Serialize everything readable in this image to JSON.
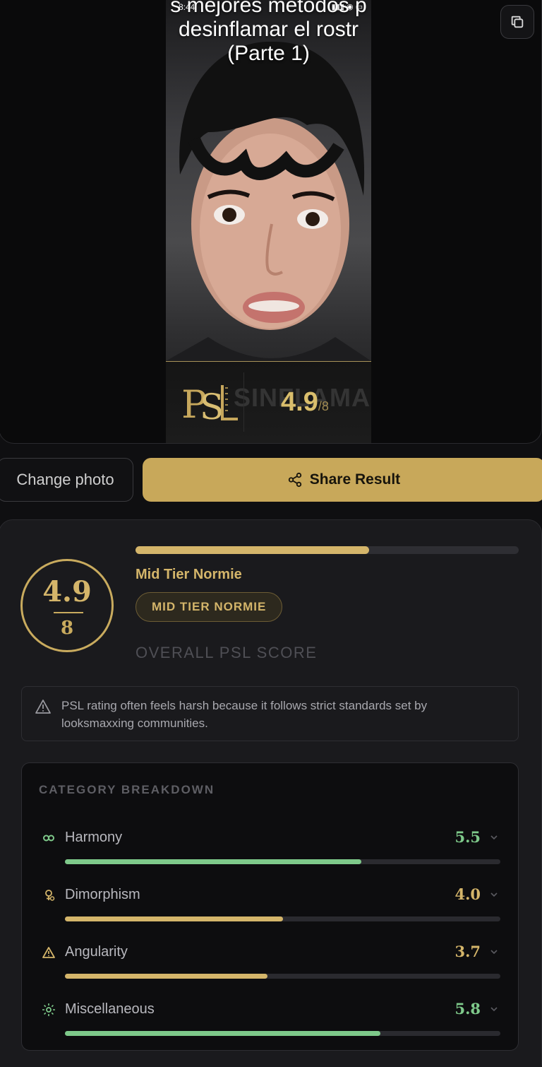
{
  "photo": {
    "overlay_line1": "s mejores métodos p",
    "overlay_line2": "desinflamar el rostr",
    "overlay_line3": "(Parte 1)",
    "status_time": "8:44",
    "watermark": "SINFLAMAR",
    "score": "4.9",
    "score_den": "/8"
  },
  "actions": {
    "change_photo": "Change photo",
    "share": "Share Result"
  },
  "result": {
    "score": "4.9",
    "denominator": "8",
    "progress_fraction": 0.61,
    "tier_title": "Mid Tier Normie",
    "tier_badge": "MID TIER NORMIE",
    "overall_label": "OVERALL PSL SCORE",
    "notice": "PSL rating often feels harsh because it follows strict standards set by looksmaxxing communities."
  },
  "breakdown": {
    "title": "CATEGORY BREAKDOWN",
    "categories": [
      {
        "name": "Harmony",
        "value": "5.5",
        "fraction": 0.68,
        "color": "#7ec98a",
        "icon": "infinity-icon"
      },
      {
        "name": "Dimorphism",
        "value": "4.0",
        "fraction": 0.5,
        "color": "#d4b56a",
        "icon": "gender-icon"
      },
      {
        "name": "Angularity",
        "value": "3.7",
        "fraction": 0.465,
        "color": "#d4b56a",
        "icon": "triangle-icon"
      },
      {
        "name": "Miscellaneous",
        "value": "5.8",
        "fraction": 0.725,
        "color": "#7ec98a",
        "icon": "sparkle-icon"
      }
    ]
  },
  "colors": {
    "accent": "#c8a85a",
    "green": "#7ec98a"
  }
}
